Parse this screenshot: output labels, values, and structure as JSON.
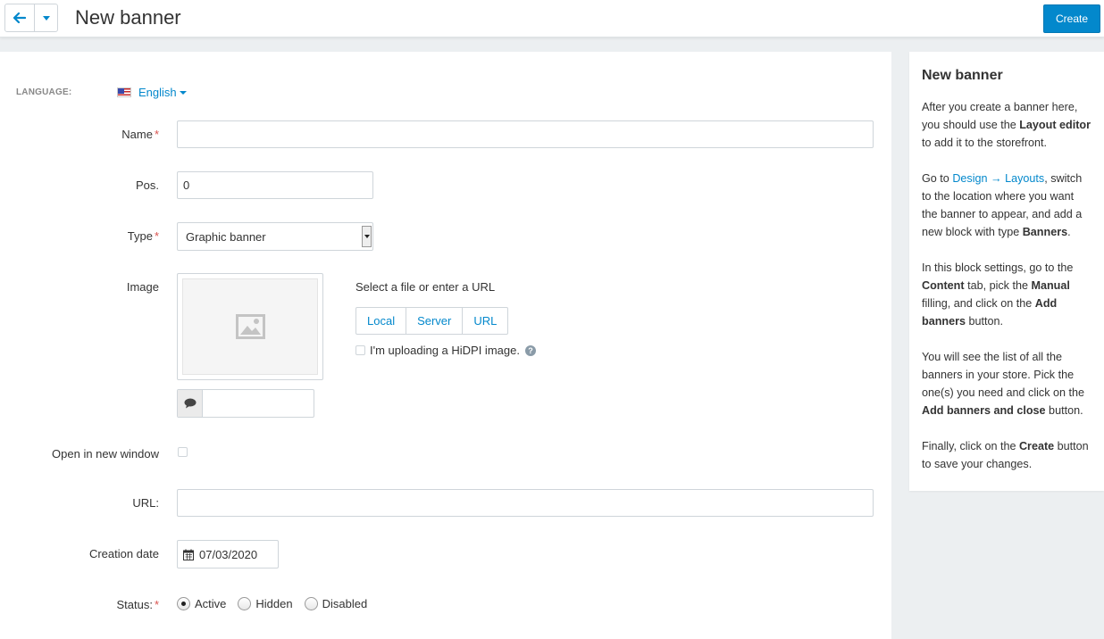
{
  "header": {
    "title": "New banner",
    "create_label": "Create"
  },
  "form": {
    "language_label": "LANGUAGE:",
    "language_value": "English",
    "name_label": "Name",
    "name_value": "",
    "pos_label": "Pos.",
    "pos_value": "0",
    "type_label": "Type",
    "type_value": "Graphic banner",
    "image_label": "Image",
    "select_file_text": "Select a file or enter a URL",
    "file_buttons": [
      "Local",
      "Server",
      "URL"
    ],
    "hidpi_label": "I'm uploading a HiDPI image.",
    "open_new_window_label": "Open in new window",
    "url_label": "URL:",
    "url_value": "",
    "creation_date_label": "Creation date",
    "creation_date_value": "07/03/2020",
    "status_label": "Status:",
    "status_options": [
      "Active",
      "Hidden",
      "Disabled"
    ],
    "status_selected": "Active"
  },
  "sidebar": {
    "title": "New banner",
    "p1_a": "After you create a banner here, you should use the ",
    "p1_b": "Layout editor",
    "p1_c": " to add it to the storefront.",
    "p2_a": "Go to ",
    "p2_link": "Design → Layouts",
    "p2_b": ", switch to the location where you want the banner to appear, and add a new block with type ",
    "p2_c": "Banners",
    "p2_d": ".",
    "p3_a": "In this block settings, go to the ",
    "p3_b": "Content",
    "p3_c": " tab, pick the ",
    "p3_d": "Manual",
    "p3_e": " filling, and click on the ",
    "p3_f": "Add banners",
    "p3_g": " button.",
    "p4_a": "You will see the list of all the banners in your store. Pick the one(s) you need and click on the ",
    "p4_b": "Add banners and close",
    "p4_c": " button.",
    "p5_a": "Finally, click on the ",
    "p5_b": "Create",
    "p5_c": " button to save your changes."
  },
  "colors": {
    "accent": "#0388cc",
    "required": "#d9534f"
  }
}
